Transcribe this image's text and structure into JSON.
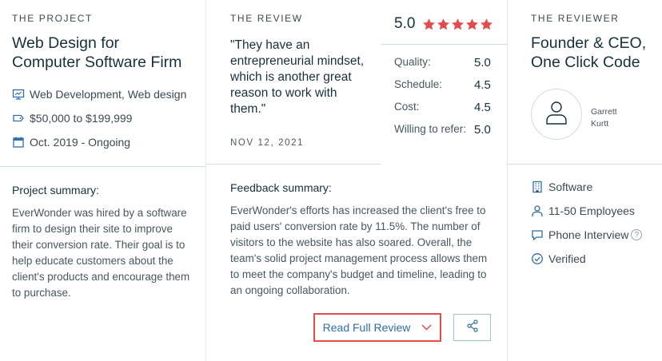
{
  "project": {
    "section_label": "THE PROJECT",
    "title_line1": "Web Design for",
    "title_line2": "Computer Software Firm",
    "service": "Web Development, Web design",
    "budget": "$50,000 to $199,999",
    "timeline": "Oct. 2019 - Ongoing",
    "summary_label": "Project summary:",
    "summary_text": "EverWonder was hired by a software firm to design their site to improve their conversion rate. Their goal is to help educate customers about the client's products and encourage them to purchase."
  },
  "review": {
    "section_label": "THE REVIEW",
    "quote": "\"They have an entrepreneurial mindset, which is another great reason to work with them.\"",
    "date": "NOV 12, 2021",
    "overall_rating": "5.0",
    "stars": 5,
    "scores": [
      {
        "label": "Quality:",
        "value": "5.0"
      },
      {
        "label": "Schedule:",
        "value": "4.5"
      },
      {
        "label": "Cost:",
        "value": "4.5"
      },
      {
        "label": "Willing to refer:",
        "value": "5.0"
      }
    ],
    "feedback_label": "Feedback summary:",
    "feedback_text": "EverWonder's efforts has increased the client's free to paid users' conversion rate by 11.5%. The number of visitors to the website has also soared. Overall, the team's solid project management process allows them to meet the company's budget and timeline, leading to an ongoing collaboration.",
    "read_full_label": "Read Full Review"
  },
  "reviewer": {
    "section_label": "THE REVIEWER",
    "title_line1": "Founder & CEO,",
    "title_line2": "One Click Code",
    "name_line1": "Garrett",
    "name_line2": "Kurtt",
    "industry": "Software",
    "employees": "11-50 Employees",
    "review_type": "Phone Interview",
    "verification": "Verified"
  },
  "colors": {
    "star": "#e44c4c",
    "button_border": "#e44c4c",
    "link": "#2f6ea7",
    "icon": "#2f6ea7"
  },
  "icons": {
    "service": "monitor-icon",
    "budget": "price-tag-icon",
    "timeline": "calendar-icon",
    "industry": "building-icon",
    "employees": "person-icon",
    "review_type": "chat-bubble-icon",
    "verification": "check-circle-icon",
    "share": "share-icon",
    "expand": "chevron-down-icon",
    "avatar": "user-icon",
    "help": "question-icon"
  }
}
